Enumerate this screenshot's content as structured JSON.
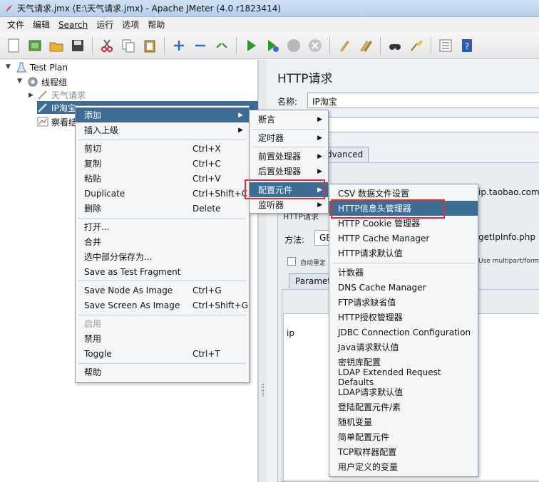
{
  "window": {
    "title": "天气请求.jmx (E:\\天气请求.jmx) - Apache JMeter (4.0 r1823414)"
  },
  "menubar": [
    "文件",
    "编辑",
    "Search",
    "运行",
    "选项",
    "帮助"
  ],
  "toolbar": {
    "icons": [
      "new-icon",
      "templates-icon",
      "open-icon",
      "save-icon",
      "cut-icon",
      "copy-icon",
      "paste-icon",
      "expand-icon",
      "collapse-icon",
      "toggle-icon",
      "start-icon",
      "start-no-pause-icon",
      "stop-icon",
      "shutdown-icon",
      "clear-icon",
      "clear-all-icon",
      "search-icon",
      "reset-search-icon",
      "function-helper-icon",
      "help-icon"
    ]
  },
  "tree": {
    "nodes": [
      {
        "label": "Test Plan",
        "icon": "flask-icon"
      },
      {
        "label": "线程组",
        "icon": "gear-icon"
      },
      {
        "label": "天气请求",
        "icon": "sampler-icon"
      },
      {
        "label": "IP淘宝",
        "icon": "sampler-icon"
      },
      {
        "label": "察看结",
        "icon": "chart-icon"
      }
    ]
  },
  "right_panel": {
    "title": "HTTP请求",
    "name_label": "名称:",
    "name_value": "IP淘宝",
    "advanced_tab": "dvanced",
    "server_value": "ip.taobao.com",
    "method_label": "方法:",
    "method_value": "GE",
    "path_value": "getIpInfo.php",
    "auto_redirect": "自动重定",
    "multipart": "Use multipart/form",
    "params_tab": "Paramete",
    "param_row": "ip",
    "section_label": "HTTP请求"
  },
  "context_menu": {
    "items": [
      {
        "label": "添加",
        "submenu": true,
        "highlight": true
      },
      {
        "label": "插入上级",
        "submenu": true
      },
      {
        "label": "剪切",
        "accel": "Ctrl+X"
      },
      {
        "label": "复制",
        "accel": "Ctrl+C"
      },
      {
        "label": "粘贴",
        "accel": "Ctrl+V"
      },
      {
        "label": "Duplicate",
        "accel": "Ctrl+Shift+C"
      },
      {
        "label": "删除",
        "accel": "Delete"
      },
      {
        "label": "打开..."
      },
      {
        "label": "合并"
      },
      {
        "label": "选中部分保存为..."
      },
      {
        "label": "Save as Test Fragment"
      },
      {
        "label": "Save Node As Image",
        "accel": "Ctrl+G"
      },
      {
        "label": "Save Screen As Image",
        "accel": "Ctrl+Shift+G"
      },
      {
        "label": "启用",
        "disabled": true
      },
      {
        "label": "禁用"
      },
      {
        "label": "Toggle",
        "accel": "Ctrl+T"
      },
      {
        "label": "帮助"
      }
    ]
  },
  "add_submenu": {
    "items": [
      {
        "label": "断言"
      },
      {
        "label": "定时器"
      },
      {
        "label": "前置处理器"
      },
      {
        "label": "后置处理器"
      },
      {
        "label": "配置元件",
        "highlight": true
      },
      {
        "label": "监听器"
      }
    ]
  },
  "config_submenu": {
    "items": [
      "CSV 数据文件设置",
      "HTTP信息头管理器",
      "HTTP Cookie 管理器",
      "HTTP Cache Manager",
      "HTTP请求默认值",
      "计数器",
      "DNS Cache Manager",
      "FTP请求缺省值",
      "HTTP授权管理器",
      "JDBC Connection Configuration",
      "Java请求默认值",
      "密钥库配置",
      "LDAP Extended Request Defaults",
      "LDAP请求默认值",
      "登陆配置元件/素",
      "随机变量",
      "简单配置元件",
      "TCP取样器配置",
      "用户定义的变量"
    ],
    "highlighted_index": 1
  },
  "colors": {
    "selection": "#3d6c94",
    "annotation": "#e03030"
  }
}
